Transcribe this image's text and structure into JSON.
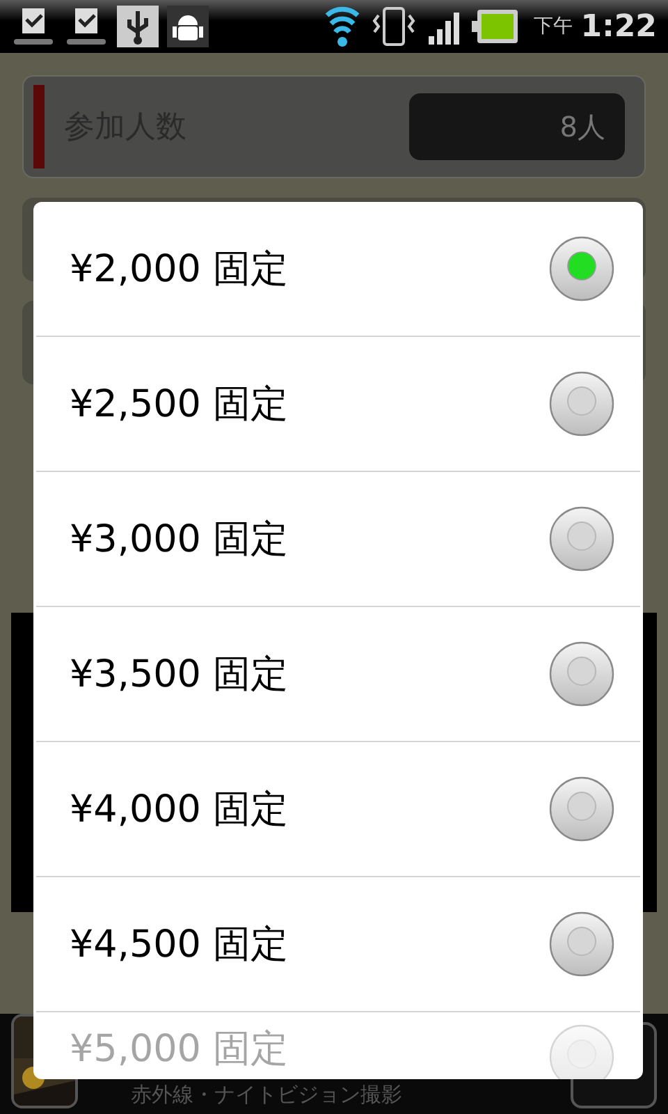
{
  "status_bar": {
    "ampm": "下午",
    "time": "1:22"
  },
  "background": {
    "field": {
      "label": "参加人数",
      "value": "8人"
    },
    "ad": {
      "text": "赤外線・ナイトビジョン撮影"
    }
  },
  "dialog": {
    "options": [
      {
        "label": "¥2,000 固定",
        "selected": true
      },
      {
        "label": "¥2,500 固定",
        "selected": false
      },
      {
        "label": "¥3,000 固定",
        "selected": false
      },
      {
        "label": "¥3,500 固定",
        "selected": false
      },
      {
        "label": "¥4,000 固定",
        "selected": false
      },
      {
        "label": "¥4,500 固定",
        "selected": false
      },
      {
        "label": "¥5,000 固定",
        "selected": false
      }
    ]
  }
}
